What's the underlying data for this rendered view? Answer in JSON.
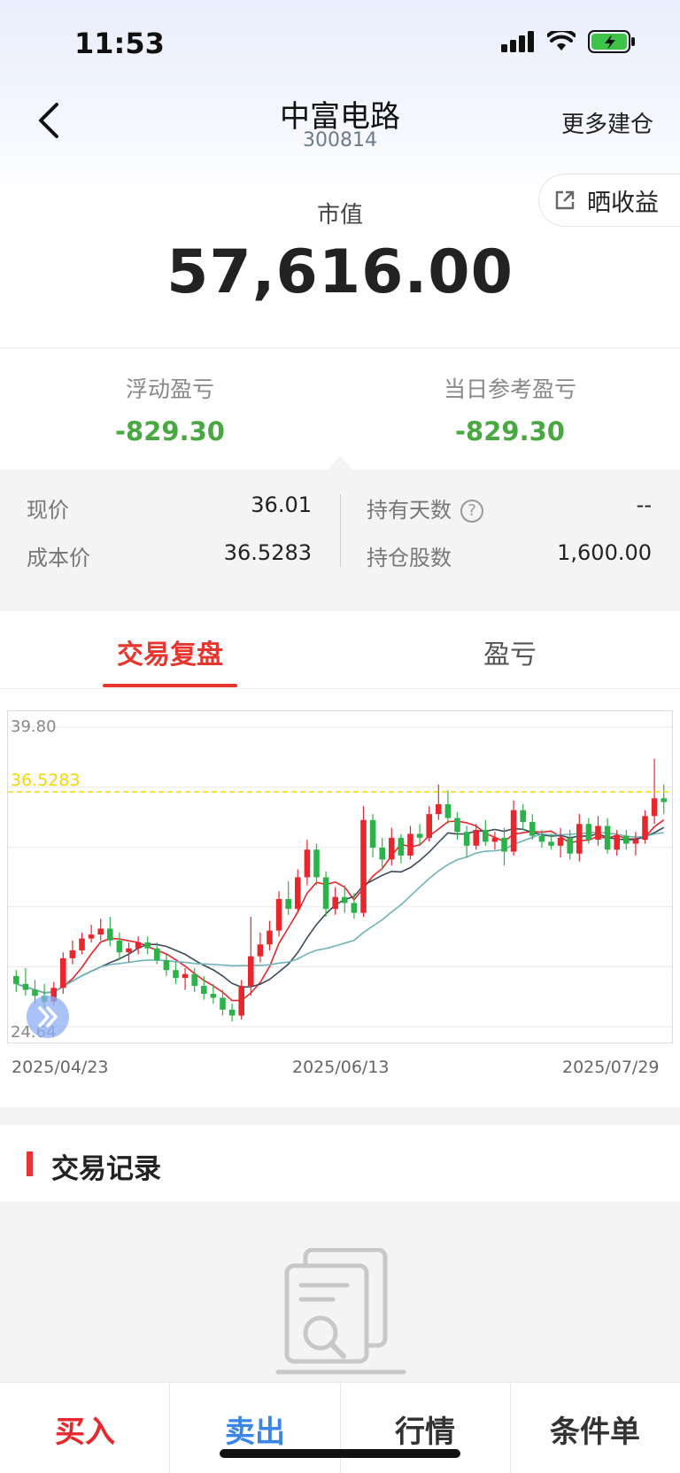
{
  "status_bar": {
    "time": "11:53"
  },
  "nav": {
    "title": "中富电路",
    "code": "300814",
    "more_label": "更多建仓"
  },
  "share": {
    "label": "晒收益"
  },
  "market_value": {
    "label": "市值",
    "value": "57,616.00"
  },
  "profit": {
    "floating_label": "浮动盈亏",
    "floating_value": "-829.30",
    "daily_label": "当日参考盈亏",
    "daily_value": "-829.30",
    "loss_color": "#4aa843"
  },
  "info": {
    "price_label": "现价",
    "price_value": "36.01",
    "cost_label": "成本价",
    "cost_value": "36.5283",
    "days_label": "持有天数",
    "days_value": "--",
    "shares_label": "持仓股数",
    "shares_value": "1,600.00"
  },
  "tabs": {
    "active": "交易复盘",
    "inactive": "盈亏"
  },
  "chart_data": {
    "type": "candlestick",
    "y_max_label": "39.80",
    "y_min_label": "24.64",
    "ylim": [
      24.64,
      39.8
    ],
    "cost_line": {
      "value": 36.5283,
      "label": "36.5283",
      "color": "#f5d800"
    },
    "dates": [
      "2025/04/23",
      "2025/06/13",
      "2025/07/29"
    ],
    "up_color": "#e8262c",
    "down_color": "#2bb34a",
    "grid": true,
    "candles": [
      [
        27.2,
        27.5,
        26.4,
        26.8
      ],
      [
        26.8,
        27.6,
        26.2,
        26.5
      ],
      [
        26.5,
        27.0,
        25.8,
        26.2
      ],
      [
        26.2,
        26.8,
        25.6,
        25.9
      ],
      [
        25.9,
        26.9,
        25.7,
        26.6
      ],
      [
        26.6,
        28.4,
        26.3,
        28.1
      ],
      [
        28.1,
        29.0,
        27.8,
        28.5
      ],
      [
        28.5,
        29.4,
        28.3,
        29.1
      ],
      [
        29.1,
        29.8,
        28.9,
        29.3
      ],
      [
        29.3,
        30.1,
        29.0,
        29.6
      ],
      [
        29.6,
        30.2,
        28.7,
        29.0
      ],
      [
        29.0,
        29.4,
        28.0,
        28.4
      ],
      [
        28.4,
        28.9,
        27.9,
        28.6
      ],
      [
        28.6,
        29.2,
        28.3,
        28.9
      ],
      [
        28.9,
        29.2,
        28.3,
        28.6
      ],
      [
        28.6,
        28.9,
        27.8,
        28.0
      ],
      [
        28.0,
        28.3,
        27.2,
        27.5
      ],
      [
        27.5,
        27.9,
        26.8,
        27.1
      ],
      [
        27.1,
        27.6,
        26.5,
        27.3
      ],
      [
        27.3,
        27.6,
        26.4,
        26.7
      ],
      [
        26.7,
        27.2,
        26.0,
        26.3
      ],
      [
        26.3,
        26.8,
        25.8,
        26.1
      ],
      [
        26.1,
        26.5,
        25.2,
        25.5
      ],
      [
        25.5,
        25.8,
        24.9,
        25.2
      ],
      [
        25.2,
        27.0,
        25.0,
        26.7
      ],
      [
        26.7,
        30.2,
        26.2,
        28.2
      ],
      [
        28.2,
        29.4,
        27.9,
        28.8
      ],
      [
        28.8,
        30.0,
        28.5,
        29.5
      ],
      [
        29.5,
        31.5,
        29.2,
        31.1
      ],
      [
        31.1,
        32.0,
        30.3,
        30.6
      ],
      [
        30.6,
        32.6,
        30.4,
        32.2
      ],
      [
        32.2,
        34.1,
        31.8,
        33.6
      ],
      [
        33.6,
        33.9,
        31.8,
        32.2
      ],
      [
        32.2,
        32.5,
        30.2,
        30.6
      ],
      [
        30.6,
        31.7,
        30.3,
        31.2
      ],
      [
        31.2,
        31.8,
        30.4,
        30.9
      ],
      [
        30.9,
        31.4,
        30.1,
        30.4
      ],
      [
        30.4,
        35.8,
        30.2,
        35.1
      ],
      [
        35.1,
        35.4,
        33.2,
        33.7
      ],
      [
        33.7,
        34.2,
        32.6,
        33.1
      ],
      [
        33.1,
        34.7,
        32.8,
        34.2
      ],
      [
        34.2,
        34.4,
        32.9,
        33.3
      ],
      [
        33.3,
        34.8,
        33.1,
        34.4
      ],
      [
        34.4,
        34.9,
        33.8,
        34.2
      ],
      [
        34.2,
        35.8,
        34.0,
        35.4
      ],
      [
        35.4,
        36.9,
        35.1,
        35.9
      ],
      [
        35.9,
        36.6,
        34.9,
        35.2
      ],
      [
        35.2,
        35.5,
        34.1,
        34.5
      ],
      [
        34.5,
        34.8,
        33.2,
        33.8
      ],
      [
        33.8,
        34.9,
        33.6,
        34.6
      ],
      [
        34.6,
        35.1,
        33.8,
        34.0
      ],
      [
        34.0,
        34.5,
        33.6,
        34.2
      ],
      [
        34.2,
        34.7,
        32.8,
        33.5
      ],
      [
        33.5,
        36.1,
        33.3,
        35.6
      ],
      [
        35.6,
        35.9,
        34.6,
        35.0
      ],
      [
        35.0,
        35.4,
        34.1,
        34.3
      ],
      [
        34.3,
        34.6,
        33.7,
        34.0
      ],
      [
        34.0,
        34.4,
        33.6,
        33.8
      ],
      [
        33.8,
        34.7,
        33.2,
        34.2
      ],
      [
        34.2,
        34.6,
        33.1,
        33.4
      ],
      [
        33.4,
        35.4,
        33.0,
        34.9
      ],
      [
        34.9,
        35.2,
        33.9,
        34.1
      ],
      [
        34.1,
        35.3,
        33.8,
        34.8
      ],
      [
        34.8,
        35.2,
        33.4,
        33.6
      ],
      [
        33.6,
        34.6,
        33.3,
        34.3
      ],
      [
        34.3,
        34.6,
        33.6,
        33.9
      ],
      [
        33.9,
        34.5,
        33.3,
        34.1
      ],
      [
        34.1,
        35.6,
        33.9,
        35.3
      ],
      [
        35.3,
        38.2,
        34.9,
        36.2
      ],
      [
        36.2,
        36.9,
        35.4,
        36.01
      ]
    ],
    "ma_lines": [
      {
        "period": 5,
        "color": "#e8262c"
      },
      {
        "period": 10,
        "color": "#3c4a5c"
      },
      {
        "period": 20,
        "color": "#6fb3b8"
      }
    ]
  },
  "records": {
    "title": "交易记录"
  },
  "bottom_bar": {
    "buy": "买入",
    "sell": "卖出",
    "quote": "行情",
    "condition": "条件单"
  }
}
